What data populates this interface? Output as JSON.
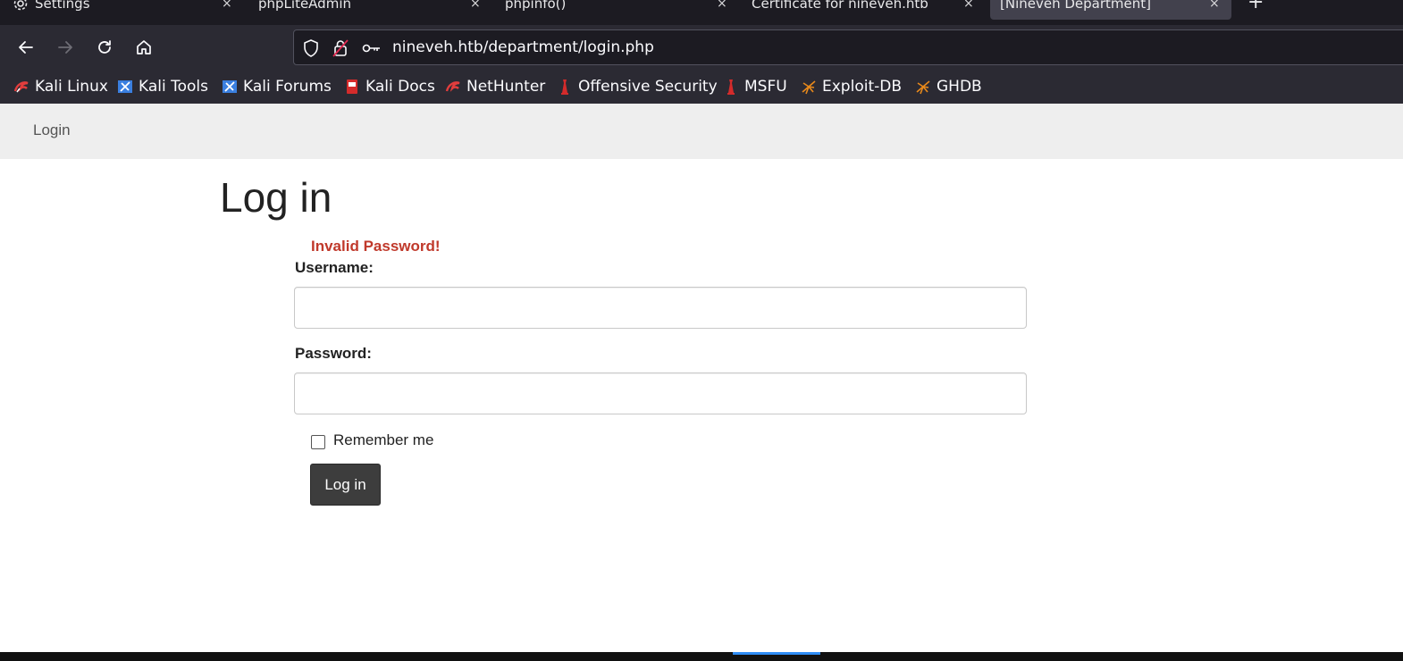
{
  "browser": {
    "tabs": [
      {
        "title": "Settings",
        "icon": "gear-icon",
        "active": false
      },
      {
        "title": "phpLiteAdmin",
        "active": false
      },
      {
        "title": "phpinfo()",
        "active": false
      },
      {
        "title": "Certificate for nineveh.htb",
        "active": false
      },
      {
        "title": "[Nineveh Department]",
        "active": true
      }
    ],
    "new_tab": "+",
    "close_glyph": "×",
    "url": "nineveh.htb/department/login.php",
    "bookmarks": [
      {
        "label": "Kali Linux",
        "icon": "kali-linux-icon",
        "color": "#e23d3d"
      },
      {
        "label": "Kali Tools",
        "icon": "kali-tools-icon",
        "color": "#3a7fe0"
      },
      {
        "label": "Kali Forums",
        "icon": "kali-forums-icon",
        "color": "#3a7fe0"
      },
      {
        "label": "Kali Docs",
        "icon": "kali-docs-icon",
        "color": "#d42b2b"
      },
      {
        "label": "NetHunter",
        "icon": "nethunter-icon",
        "color": "#e23d3d"
      },
      {
        "label": "Offensive Security",
        "icon": "offsec-icon",
        "color": "#d42b2b"
      },
      {
        "label": "MSFU",
        "icon": "msfu-icon",
        "color": "#d42b2b"
      },
      {
        "label": "Exploit-DB",
        "icon": "exploit-db-icon",
        "color": "#e8891b"
      },
      {
        "label": "GHDB",
        "icon": "ghdb-icon",
        "color": "#e8891b"
      }
    ]
  },
  "page": {
    "nav_link": "Login",
    "heading": "Log in",
    "error": "Invalid Password!",
    "username_label": "Username:",
    "username_value": "",
    "password_label": "Password:",
    "password_value": "",
    "remember_label": "Remember me",
    "remember_checked": false,
    "submit_label": "Log in"
  },
  "colors": {
    "error": "#c0392b",
    "button_bg": "#3d3d3d",
    "nav_bg": "#eeeeee"
  }
}
